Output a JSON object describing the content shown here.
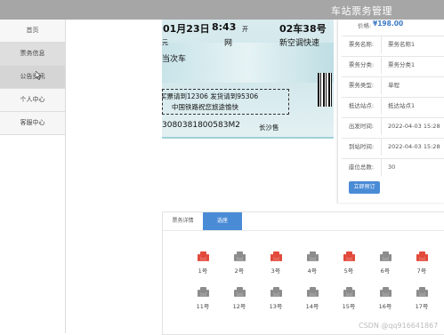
{
  "header": {
    "title": "车站票务管理"
  },
  "sidebar": {
    "items": [
      {
        "label": "首页"
      },
      {
        "label": "票务信息"
      },
      {
        "label": "公告资讯"
      },
      {
        "label": "个人中心"
      },
      {
        "label": "客服中心"
      }
    ]
  },
  "ticket_image": {
    "line1_date": "01月23日",
    "line1_time": "8:43",
    "line1_kai": "开",
    "line1_car": "02车38号",
    "line2_yuan": "元",
    "line2_wang": "网",
    "line2_class": "新空调快速",
    "line3": "当次车",
    "notice1": "买票请到12306 发货请到95306",
    "notice2": "中国铁路祝您旅途愉快",
    "serial": "308038180058",
    "serial_suffix": "3M2",
    "station": "长沙售"
  },
  "details": {
    "price_label": "价格:",
    "price_value": "¥198.00",
    "rows": [
      {
        "label": "票务名称:",
        "value": "票务名称1"
      },
      {
        "label": "票务分类:",
        "value": "票务分类1"
      },
      {
        "label": "票务类型:",
        "value": "单程"
      },
      {
        "label": "抵达站点:",
        "value": "抵达站点1"
      },
      {
        "label": "出发时间:",
        "value": "2022-04-03 15:28"
      },
      {
        "label": "到站时间:",
        "value": "2022-04-03 15:28"
      },
      {
        "label": "座位总数:",
        "value": "30"
      }
    ],
    "book_button": "立即预订"
  },
  "tabs": [
    {
      "label": "票务详情"
    },
    {
      "label": "选座"
    }
  ],
  "seats": [
    {
      "label": "1号",
      "status": "taken"
    },
    {
      "label": "2号",
      "status": "free"
    },
    {
      "label": "3号",
      "status": "taken"
    },
    {
      "label": "4号",
      "status": "free"
    },
    {
      "label": "5号",
      "status": "taken"
    },
    {
      "label": "6号",
      "status": "free"
    },
    {
      "label": "7号",
      "status": "taken"
    },
    {
      "label": "11号",
      "status": "free"
    },
    {
      "label": "12号",
      "status": "free"
    },
    {
      "label": "13号",
      "status": "free"
    },
    {
      "label": "14号",
      "status": "free"
    },
    {
      "label": "15号",
      "status": "free"
    },
    {
      "label": "16号",
      "status": "free"
    },
    {
      "label": "17号",
      "status": "free"
    }
  ],
  "colors": {
    "taken": "#e24a3b",
    "free": "#8c8c8c",
    "accent": "#4a8bd6"
  },
  "watermark": "CSDN @qq916641867"
}
